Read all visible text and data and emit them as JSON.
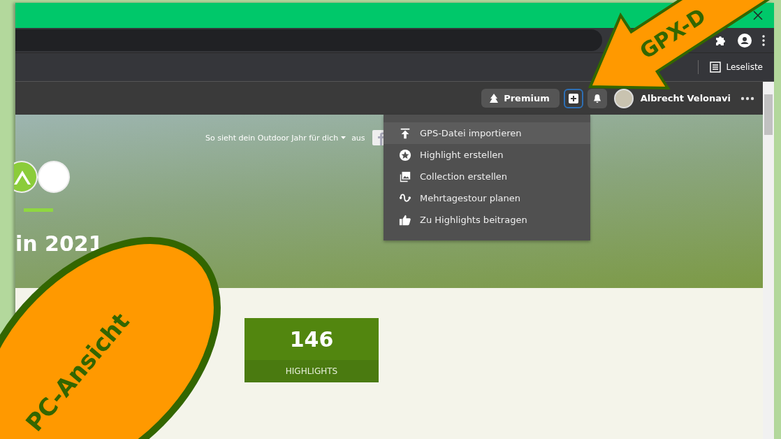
{
  "browser": {
    "reading_list": "Leseliste"
  },
  "header": {
    "premium_button": "Premium",
    "create_button": {
      "selected": true
    },
    "user_name": "Albrecht Velonavi"
  },
  "create_menu": {
    "items": [
      {
        "label": "GPS-Datei importieren",
        "kind": "upload",
        "selected": true
      },
      {
        "label": "Highlight erstellen",
        "kind": "star",
        "selected": false
      },
      {
        "label": "Collection erstellen",
        "kind": "gallery",
        "selected": false
      },
      {
        "label": "Mehrtagestour planen",
        "kind": "route",
        "selected": false
      },
      {
        "label": "Zu Highlights beitragen",
        "kind": "thumb",
        "selected": false
      }
    ]
  },
  "hero": {
    "share_text": "So sieht dein Outdoor Jahr für dich",
    "share_suffix": "aus",
    "title": "in 2021"
  },
  "stats": [
    {
      "value": "146",
      "label": "HIGHLIGHTS"
    }
  ],
  "annotations": [
    {
      "kind": "arrow",
      "label": "GPX-D"
    },
    {
      "kind": "ellipse",
      "label": "PC-Ansicht"
    }
  ]
}
